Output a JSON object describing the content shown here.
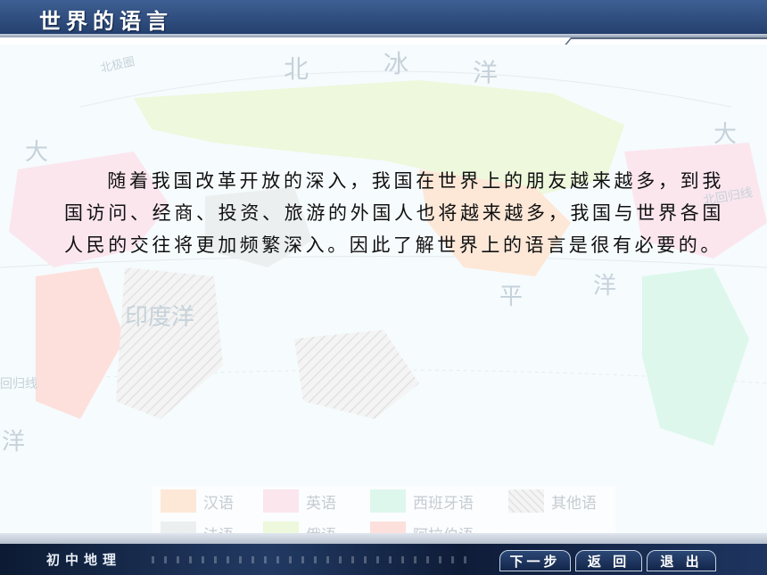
{
  "header": {
    "title": "世界的语言"
  },
  "map": {
    "labels": {
      "arctic_circle": "北极圈",
      "arctic_ocean_1": "北",
      "arctic_ocean_2": "冰",
      "arctic_ocean_3": "洋",
      "tropic_right": "北回归线",
      "tropic_left": "回归线",
      "indian_ocean": "印度洋",
      "pacific_1": "平",
      "pacific_2": "洋",
      "atlantic_right": "大",
      "atlantic_left": "大",
      "ocean_left": "洋"
    },
    "colors": {
      "ocean": "#f6fbfd",
      "chinese": "#fde8d8",
      "english": "#fbe6ee",
      "spanish": "#def7ec",
      "french": "#eceff0",
      "russian": "#edf8dc",
      "arabic": "#fde0dc",
      "other": "#f1f1f1"
    }
  },
  "paragraph": "随着我国改革开放的深入，我国在世界上的朋友越来越多，到我国访问、经商、投资、旅游的外国人也将越来越多，我国与世界各国人民的交往将更加频繁深入。因此了解世界上的语言是很有必要的。",
  "legend": {
    "items": [
      {
        "label": "汉语",
        "color": "#fde8d8"
      },
      {
        "label": "英语",
        "color": "#fbe6ee"
      },
      {
        "label": "西班牙语",
        "color": "#def7ec"
      },
      {
        "label": "其他语",
        "color": "hatched"
      },
      {
        "label": "法语",
        "color": "#eceff0"
      },
      {
        "label": "俄语",
        "color": "#edf8dc"
      },
      {
        "label": "阿拉伯语",
        "color": "#fde0dc"
      }
    ]
  },
  "footer": {
    "brand": "初中地理",
    "next_label": "下一步",
    "back_label": "返 回",
    "exit_label": "退 出"
  }
}
